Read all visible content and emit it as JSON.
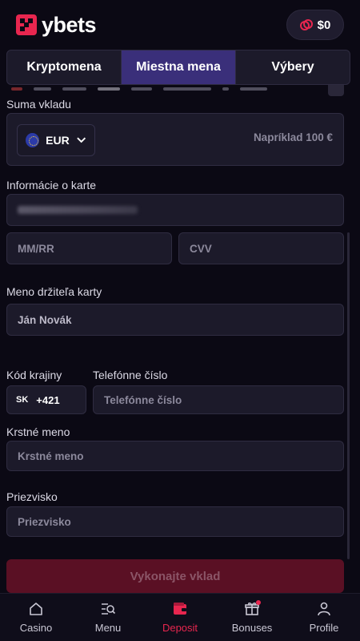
{
  "header": {
    "logo_text": "ybets",
    "balance": "$0",
    "brand_color": "#e8264f"
  },
  "tabs": [
    {
      "label": "Kryptomena",
      "active": false
    },
    {
      "label": "Miestna mena",
      "active": true
    },
    {
      "label": "Výbery",
      "active": false
    }
  ],
  "deposit": {
    "amount_label": "Suma vkladu",
    "currency": "EUR",
    "amount_placeholder": "Napríklad 100 €",
    "card_info_label": "Informácie o karte",
    "expiry_placeholder": "MM/RR",
    "cvv_placeholder": "CVV",
    "holder_label": "Meno držiteľa karty",
    "holder_value": "Ján Novák",
    "country_code_label": "Kód krajiny",
    "country_iso": "SK",
    "country_prefix": "+421",
    "phone_label": "Telefónne číslo",
    "phone_placeholder": "Telefónne číslo",
    "first_name_label": "Krstné meno",
    "first_name_placeholder": "Krstné meno",
    "last_name_label": "Priezvisko",
    "last_name_placeholder": "Priezvisko",
    "submit_label": "Vykonajte vklad"
  },
  "bottom_nav": [
    {
      "label": "Casino",
      "icon": "home-icon",
      "active": false
    },
    {
      "label": "Menu",
      "icon": "menu-search-icon",
      "active": false
    },
    {
      "label": "Deposit",
      "icon": "wallet-icon",
      "active": true
    },
    {
      "label": "Bonuses",
      "icon": "gift-icon",
      "active": false,
      "badge": true
    },
    {
      "label": "Profile",
      "icon": "user-icon",
      "active": false
    }
  ]
}
